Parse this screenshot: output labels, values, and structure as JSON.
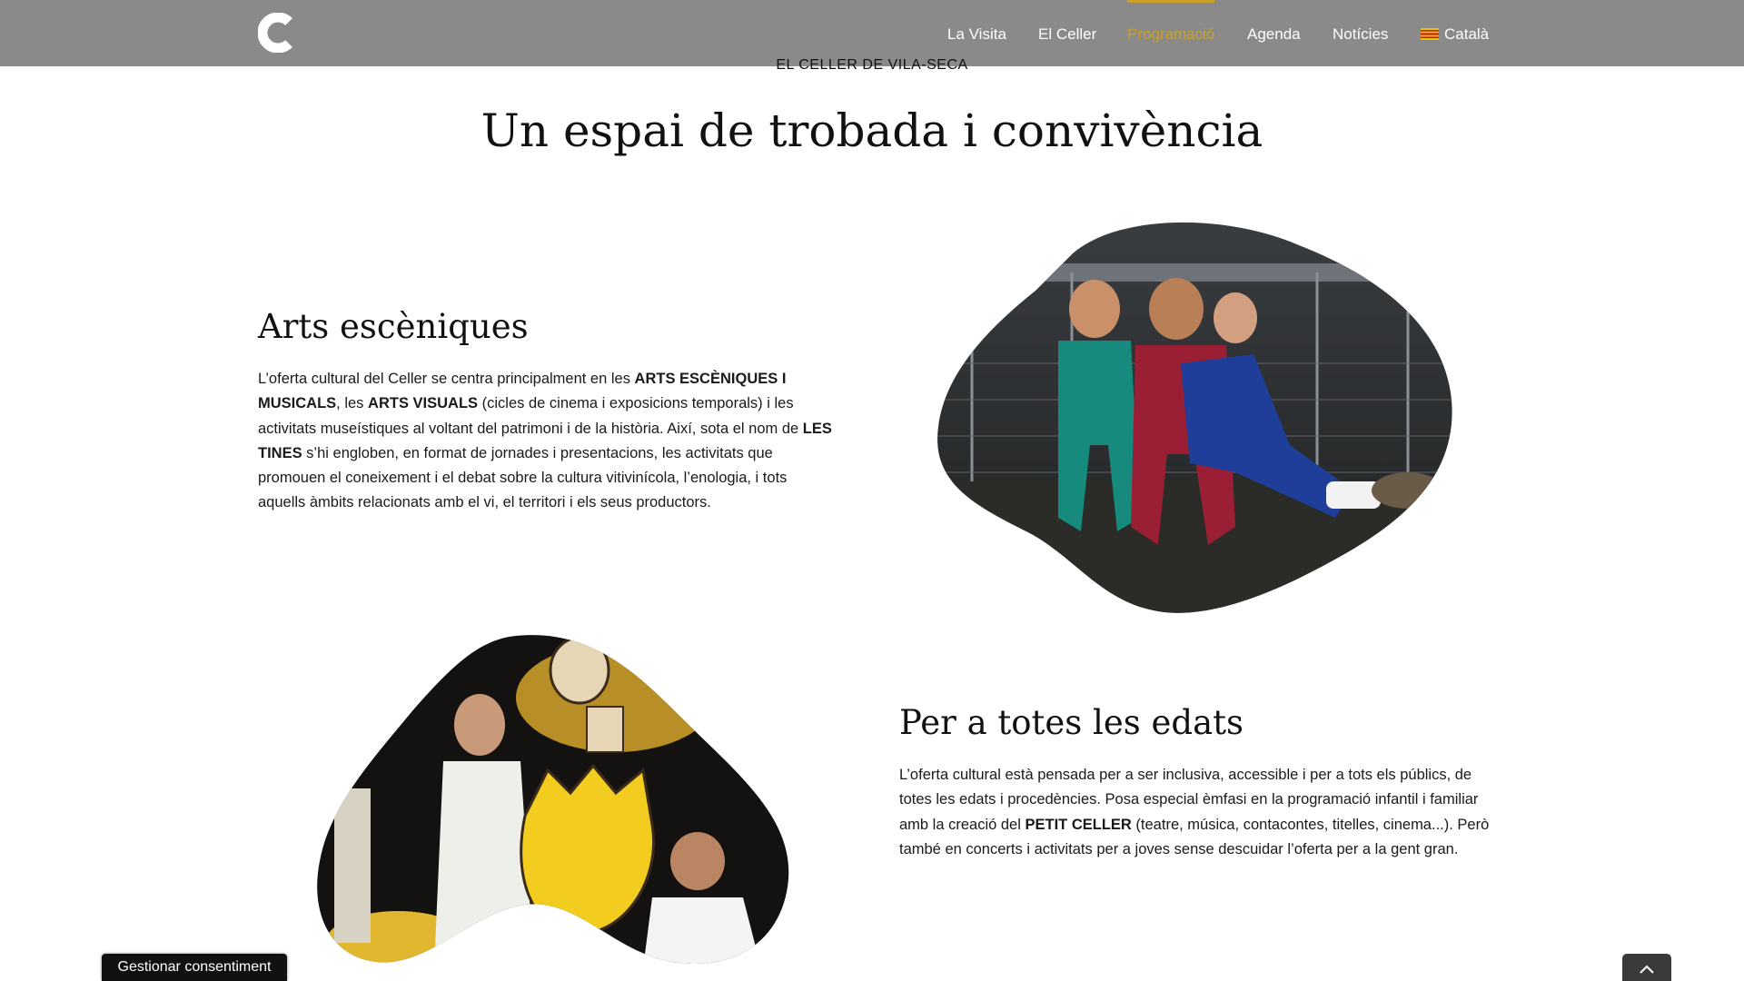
{
  "nav": {
    "logo_icon": "celler-c-logo",
    "items": [
      {
        "label": "La Visita"
      },
      {
        "label": "El Celler"
      },
      {
        "label": "Programació",
        "active": true
      },
      {
        "label": "Agenda"
      },
      {
        "label": "Notícies"
      },
      {
        "label": "Català",
        "icon": "catalan-flag-icon"
      }
    ],
    "colors": {
      "bar": "#8a8a8a",
      "active": "#c9a227",
      "text": "#ffffff"
    }
  },
  "hero": {
    "kicker": "EL CELLER DE VILA-SECA",
    "title": "Un espai de trobada i convivència"
  },
  "sections": [
    {
      "title": "Arts escèniques",
      "body": [
        {
          "t": "L’oferta cultural del Celler se centra principalment en les "
        },
        {
          "t": "ARTS ESCÈNIQUES I MUSICALS",
          "b": true
        },
        {
          "t": ", les "
        },
        {
          "t": "ARTS VISUALS",
          "b": true
        },
        {
          "t": " (cicles de cinema i exposicions temporals) i les activitats museístiques al voltant del patrimoni i de la història. Així, sota el nom de "
        },
        {
          "t": "LES TINES",
          "b": true
        },
        {
          "t": " s’hi engloben, en format de jornades i presentacions, les activitats que promouen el coneixement i el debat sobre la cultura vitivinícola, l’enologia, i tots aquells àmbits relacionats amb el vi, el territori i els seus productors."
        }
      ],
      "image": "photo-three-performers-in-tracksuits"
    },
    {
      "title": "Per a totes les edats",
      "body": [
        {
          "t": "L’oferta cultural està pensada per a ser inclusiva, accessible i per a tots els públics, de totes les edats i procedències. Posa especial èmfasi en la programació infantil i familiar amb la creació del "
        },
        {
          "t": "PETIT CELLER",
          "b": true
        },
        {
          "t": " (teatre, música, contacontes, titelles, cinema...). Però també en concerts i activitats per a joves sense descuidar l’oferta per a la gent gran."
        }
      ],
      "image": "photo-puppet-theatre-performers"
    }
  ],
  "footer": {
    "consent_label": "Gestionar consentiment",
    "totop_icon": "chevron-up-icon"
  }
}
